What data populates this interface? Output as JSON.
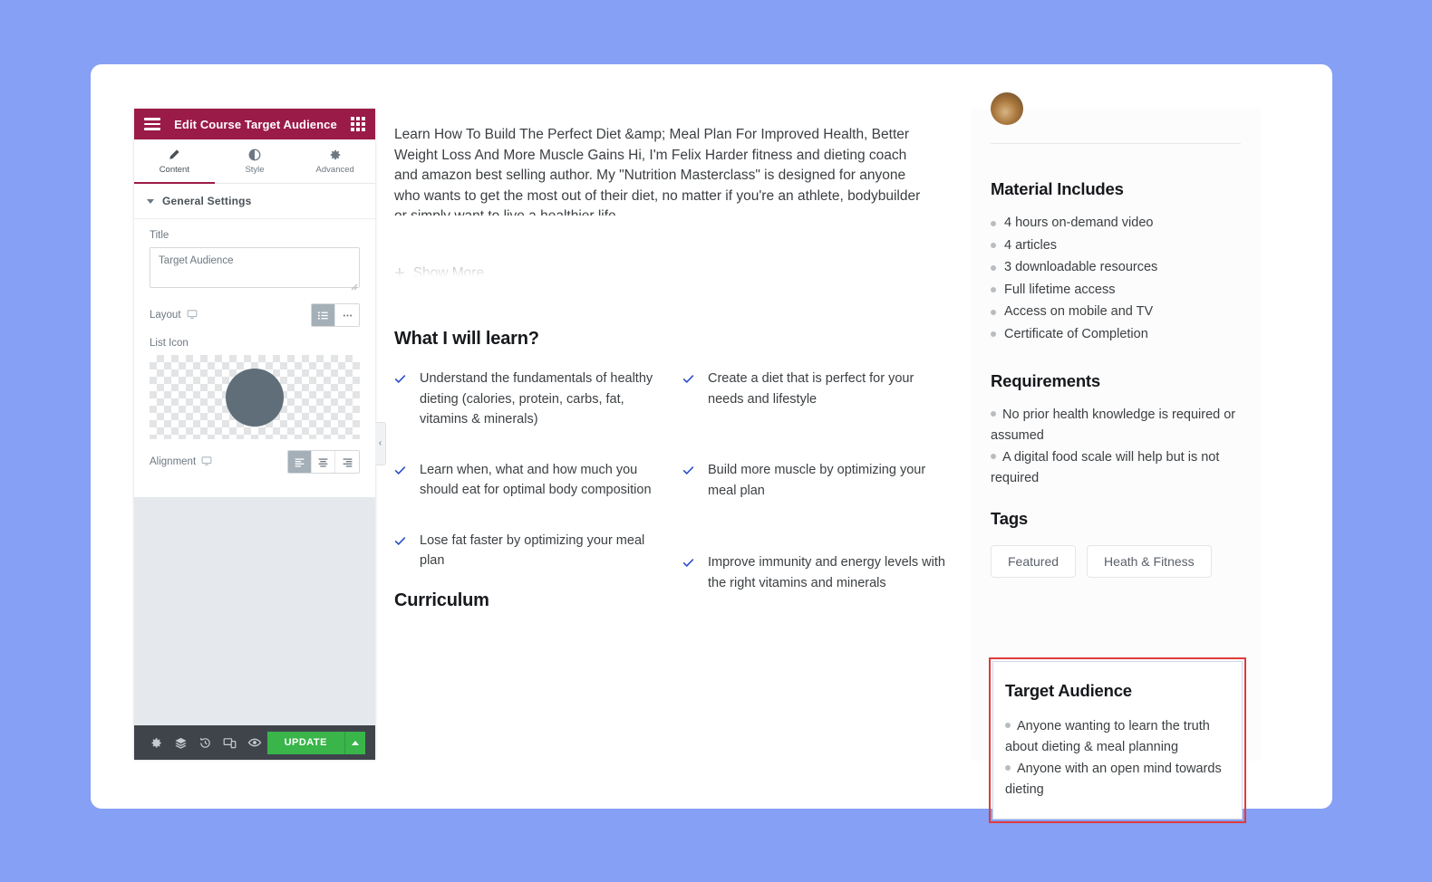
{
  "theme": {
    "page_background": "#85a0f5",
    "panel_header_bg": "#9b1b48",
    "update_button_bg": "#39b54a",
    "selection_outline": "#e03c3c",
    "check_color": "#2b50c8"
  },
  "panel": {
    "header": {
      "title": "Edit Course Target Audience",
      "menu_icon": "hamburger-icon",
      "widgets_icon": "grid-icon"
    },
    "tabs": [
      {
        "label": "Content",
        "icon": "pencil-icon",
        "active": true
      },
      {
        "label": "Style",
        "icon": "contrast-circle-icon",
        "active": false
      },
      {
        "label": "Advanced",
        "icon": "gear-icon",
        "active": false
      }
    ],
    "section": {
      "title": "General Settings",
      "expanded": true
    },
    "controls": {
      "title_label": "Title",
      "title_value": "Target Audience",
      "title_placeholder": "Target Audience",
      "layout_label": "Layout",
      "layout_options": [
        "list-view",
        "more-options"
      ],
      "layout_selected": "list-view",
      "list_icon_label": "List Icon",
      "alignment_label": "Alignment",
      "alignment_options": [
        "align-left",
        "align-center",
        "align-right"
      ],
      "alignment_selected": "align-left"
    },
    "footer": {
      "icons": [
        "settings-gear-icon",
        "layers-icon",
        "history-icon",
        "responsive-mode-icon",
        "preview-eye-icon"
      ],
      "update_label": "UPDATE",
      "update_caret": "caret-up-icon"
    },
    "collapse_handle": "‹"
  },
  "preview": {
    "description": {
      "text": "Learn How To Build The Perfect Diet &amp; Meal Plan For Improved Health, Better Weight Loss And More Muscle Gains Hi, I'm Felix Harder fitness and dieting coach and amazon best selling author. My \"Nutrition Masterclass\" is designed for anyone who wants to get the most out of their diet, no matter if you're an athlete, bodybuilder or simply want to live a healthier life.",
      "show_more_label": "Show More"
    },
    "learn": {
      "heading": "What I will learn?",
      "column_left": [
        "Understand the fundamentals of healthy dieting (calories, protein, carbs, fat, vitamins & minerals)",
        "Learn when, what and how much you should eat for optimal body composition",
        "Lose fat faster by optimizing your meal plan"
      ],
      "column_right": [
        "Create a diet that is perfect for your needs and lifestyle",
        "Build more muscle by optimizing your meal plan",
        "Improve immunity and energy levels with the right vitamins and minerals"
      ]
    },
    "curriculum_heading": "Curriculum",
    "sidebar": {
      "material": {
        "heading": "Material Includes",
        "items": [
          "4 hours on-demand video",
          "4 articles",
          "3 downloadable resources",
          "Full lifetime access",
          "Access on mobile and TV",
          "Certificate of Completion"
        ]
      },
      "requirements": {
        "heading": "Requirements",
        "items": [
          "No prior health knowledge is required or assumed",
          "A digital food scale will help but is not required"
        ]
      },
      "tags": {
        "heading": "Tags",
        "items": [
          "Featured",
          "Heath & Fitness"
        ]
      },
      "target_audience": {
        "heading": "Target Audience",
        "items": [
          "Anyone wanting to learn the truth about dieting & meal planning",
          "Anyone with an open mind towards dieting"
        ]
      }
    }
  }
}
